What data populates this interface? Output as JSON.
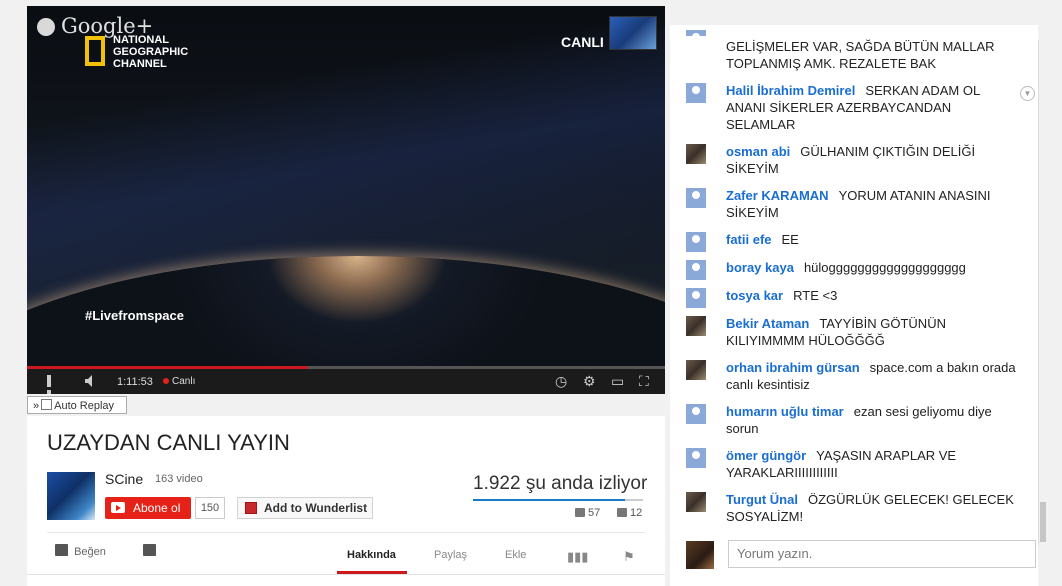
{
  "player": {
    "brand_gplus": "Google+",
    "brand_ng": "NATIONAL GEOGRAPHIC CHANNEL",
    "live_badge": "CANLI",
    "overlay_hashtag": "#Livefromspace",
    "time": "1:11:53",
    "live_label": "Canlı",
    "progress": 0.44
  },
  "auto_replay": {
    "prefix": "»",
    "label": "Auto Replay"
  },
  "video": {
    "title": "UZAYDAN CANLI YAYIN",
    "channel": "SCine",
    "video_count": "163 video",
    "subscribe_label": "Abone ol",
    "subscriber_count": "150",
    "wunderlist_label": "Add to Wunderlist",
    "watching": "1.922 şu anda izliyor",
    "likes": "57",
    "dislikes": "12",
    "like_label": "Beğen"
  },
  "tabs": [
    {
      "label": "Hakkında",
      "active": true
    },
    {
      "label": "Paylaş"
    },
    {
      "label": "Ekle"
    }
  ],
  "chat": {
    "input_placeholder": "Yorum yazın.",
    "messages": [
      {
        "author": "",
        "text": "GELİŞMELER VAR, SAĞDA BÜTÜN MALLAR TOPLANMIŞ AMK. REZALETE BAK",
        "avatar": "default"
      },
      {
        "author": "Halil İbrahim Demirel",
        "text": "SERKAN ADAM OL ANANI SİKERLER AZERBAYCANDAN SELAMLAR",
        "avatar": "default"
      },
      {
        "author": "osman abi",
        "text": "GÜLHANIM ÇIKTIĞIN DELİĞİ SİKEYİM",
        "avatar": "photo"
      },
      {
        "author": "Zafer KARAMAN",
        "text": "YORUM ATANIN ANASINI SİKEYİM",
        "avatar": "default"
      },
      {
        "author": "fatii efe",
        "text": "EE",
        "avatar": "default"
      },
      {
        "author": "boray kaya",
        "text": "hüloggggggggggggggggggg",
        "avatar": "default"
      },
      {
        "author": "tosya kar",
        "text": "RTE <3",
        "avatar": "default"
      },
      {
        "author": "Bekir Ataman",
        "text": "TAYYİBİN GÖTÜNÜN KILIYIMMMM HÜLOĞĞĞĞ",
        "avatar": "photo"
      },
      {
        "author": "orhan ibrahim gürsan",
        "text": "space.com a bakın orada canlı kesintisiz",
        "avatar": "photo"
      },
      {
        "author": "humarın uğlu timar",
        "text": "ezan sesi geliyomu diye sorun",
        "avatar": "default"
      },
      {
        "author": "ömer güngör",
        "text": "YAŞASIN ARAPLAR VE YARAKLARIIIIIIIIIIII",
        "avatar": "default"
      },
      {
        "author": "Turgut Ünal",
        "text": "ÖZGÜRLÜK GELECEK! GELECEK SOSYALİZM!",
        "avatar": "photo"
      }
    ]
  }
}
